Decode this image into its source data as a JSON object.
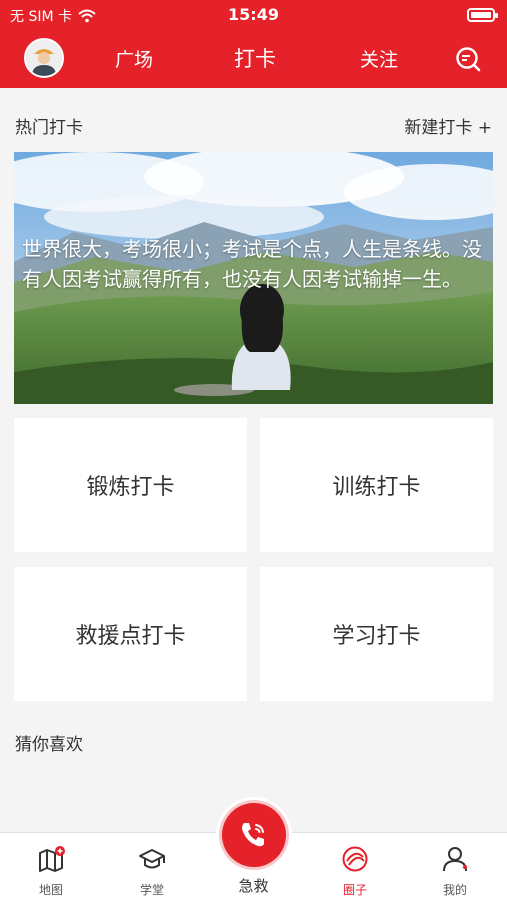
{
  "status_bar": {
    "carrier": "无 SIM 卡",
    "time": "15:49"
  },
  "nav": {
    "tabs": [
      "广场",
      "打卡",
      "关注"
    ],
    "active_tab": "打卡"
  },
  "hot": {
    "title": "热门打卡",
    "new_button": "新建打卡 +",
    "banner_quote": "世界很大，考场很小；考试是个点，人生是条线。没有人因考试赢得所有，也没有人因考试输掉一生。"
  },
  "cards": [
    "锻炼打卡",
    "训练打卡",
    "救援点打卡",
    "学习打卡"
  ],
  "guess_title": "猜你喜欢",
  "tabbar": {
    "items": [
      {
        "label": "地图",
        "icon": "map-icon"
      },
      {
        "label": "学堂",
        "icon": "graduation-cap-icon"
      },
      {
        "label": "急救",
        "icon": "phone-icon"
      },
      {
        "label": "圈子",
        "icon": "circle-icon"
      },
      {
        "label": "我的",
        "icon": "user-icon"
      }
    ],
    "active": "圈子"
  },
  "colors": {
    "primary": "#e5212a",
    "background": "#f4f4f4"
  }
}
